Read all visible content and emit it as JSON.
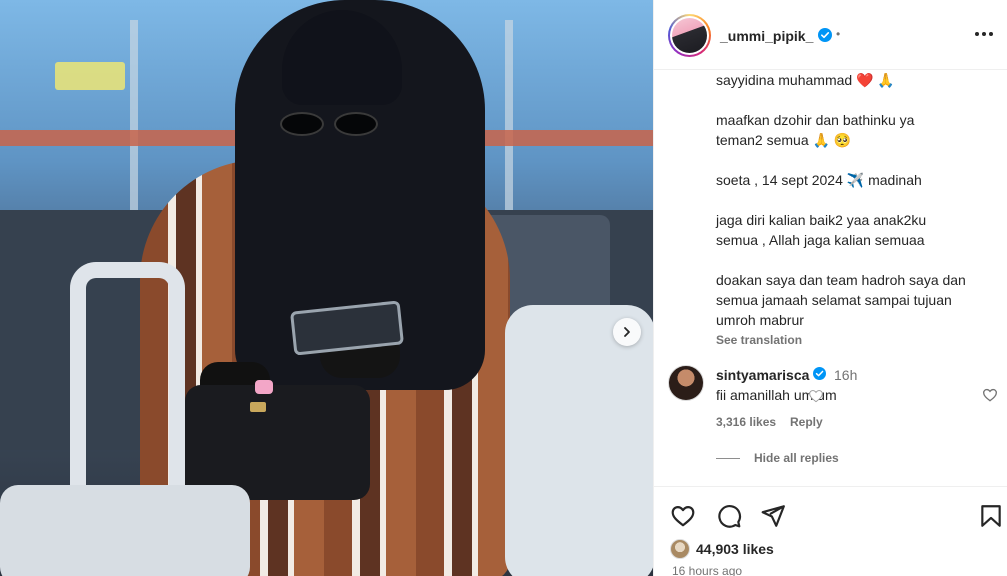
{
  "post": {
    "username": "_ummi_pipik_",
    "separator": "•",
    "caption_lines": [
      [
        "sayyidina muhammad ❤️ 🙏"
      ],
      [
        "maafkan dzohir dan bathinku ya",
        "teman2 semua 🙏 🥺"
      ],
      [
        "soeta , 14 sept 2024 ✈️ madinah"
      ],
      [
        "jaga diri kalian baik2 yaa anak2ku",
        "semua , Allah jaga kalian semuaa"
      ],
      [
        "doakan saya dan team hadroh saya dan",
        "semua jamaah selamat sampai tujuan",
        "umroh mabrur"
      ]
    ],
    "see_translation": "See translation",
    "likes": "44,903 likes",
    "timestamp": "16 hours ago"
  },
  "comment": {
    "username": "sintyamarisca",
    "time": "16h",
    "text": "fii amanillah um um",
    "likes": "3,316 likes",
    "reply_label": "Reply",
    "hide_replies": "Hide all replies"
  },
  "icons": {
    "verified": "verified-badge-icon",
    "more": "more-options-icon",
    "next": "chevron-right-icon",
    "like": "heart-icon",
    "comment": "comment-icon",
    "share": "share-icon",
    "save": "bookmark-icon"
  },
  "colors": {
    "verified": "#0095f6",
    "text": "#262626",
    "muted": "#737373"
  }
}
